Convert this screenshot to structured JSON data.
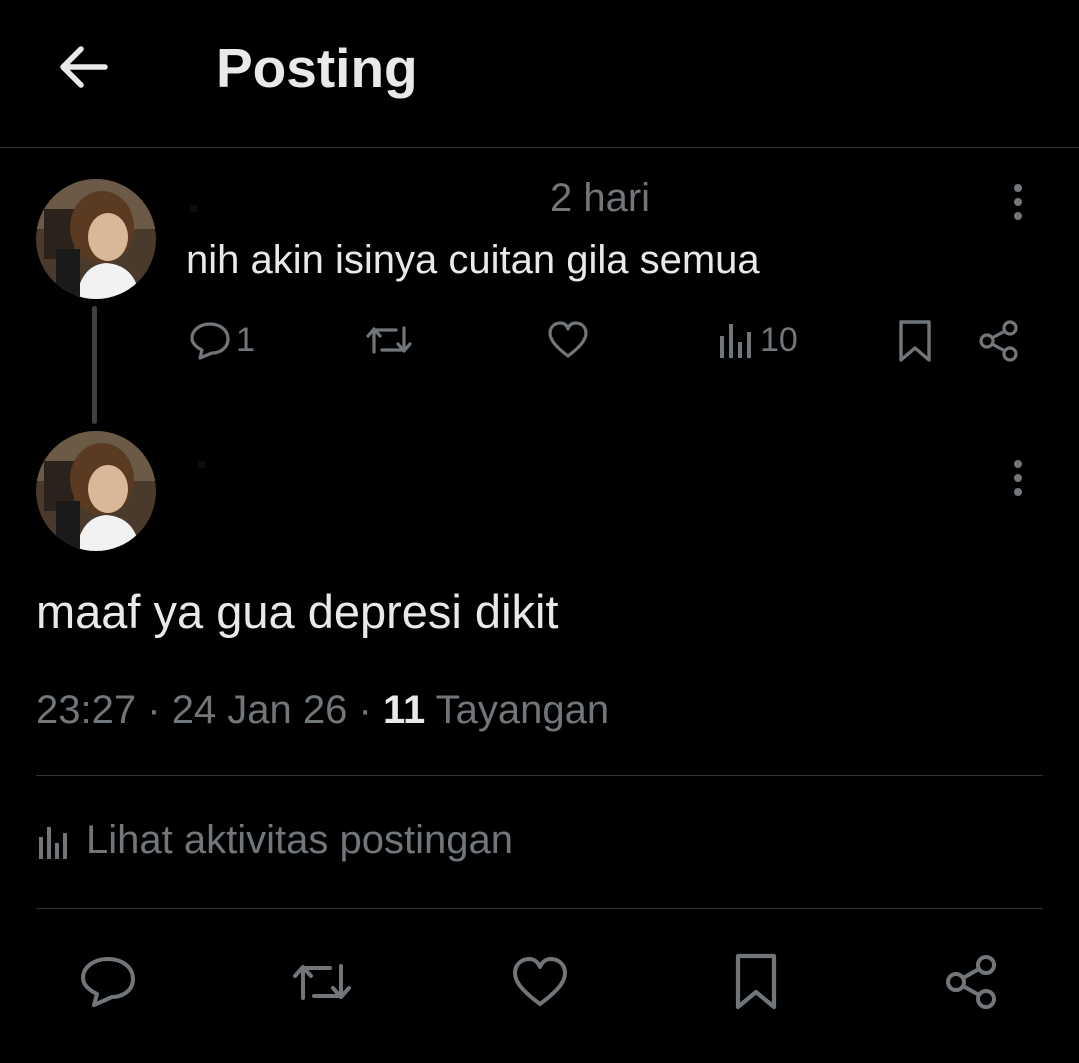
{
  "header": {
    "title": "Posting",
    "back_icon": "arrow-left-icon"
  },
  "reply": {
    "time_ago": "2 hari",
    "text": "nih akin isinya cuitan gila semua",
    "actions": {
      "reply_count": "1",
      "views_count": "10"
    }
  },
  "post": {
    "text": "maaf ya gua depresi dikit",
    "time": "23:27",
    "separator": "·",
    "date": "24 Jan 26",
    "views_count": "11",
    "views_label": "Tayangan"
  },
  "activity": {
    "label": "Lihat aktivitas postingan"
  },
  "colors": {
    "background": "#000000",
    "text_primary": "#e7e9ea",
    "text_secondary": "#71767b",
    "divider": "#2f3336"
  }
}
